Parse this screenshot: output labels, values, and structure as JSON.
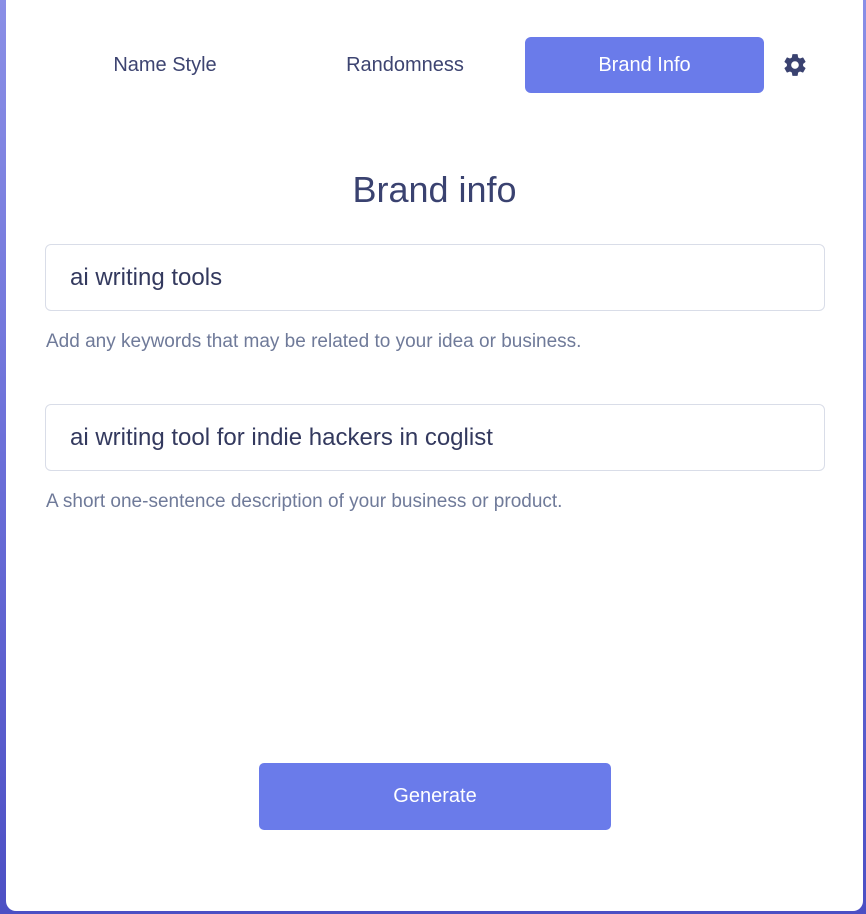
{
  "tabs": [
    {
      "label": "Name Style",
      "active": false
    },
    {
      "label": "Randomness",
      "active": false
    },
    {
      "label": "Brand Info",
      "active": true
    }
  ],
  "settings": {
    "icon": "gear-icon"
  },
  "section": {
    "title": "Brand info"
  },
  "keywords": {
    "value": "ai writing tools",
    "hint": "Add any keywords that may be related to your idea or business."
  },
  "description": {
    "value": "ai writing tool for indie hackers in coglist",
    "hint": "A short one-sentence description of your business or product."
  },
  "actions": {
    "generate_label": "Generate"
  },
  "colors": {
    "accent": "#6a7bea",
    "text": "#3a4270",
    "muted": "#6f7a99",
    "background_gradient_top": "#8a8fe6",
    "background_gradient_bottom": "#4c4fc4"
  }
}
